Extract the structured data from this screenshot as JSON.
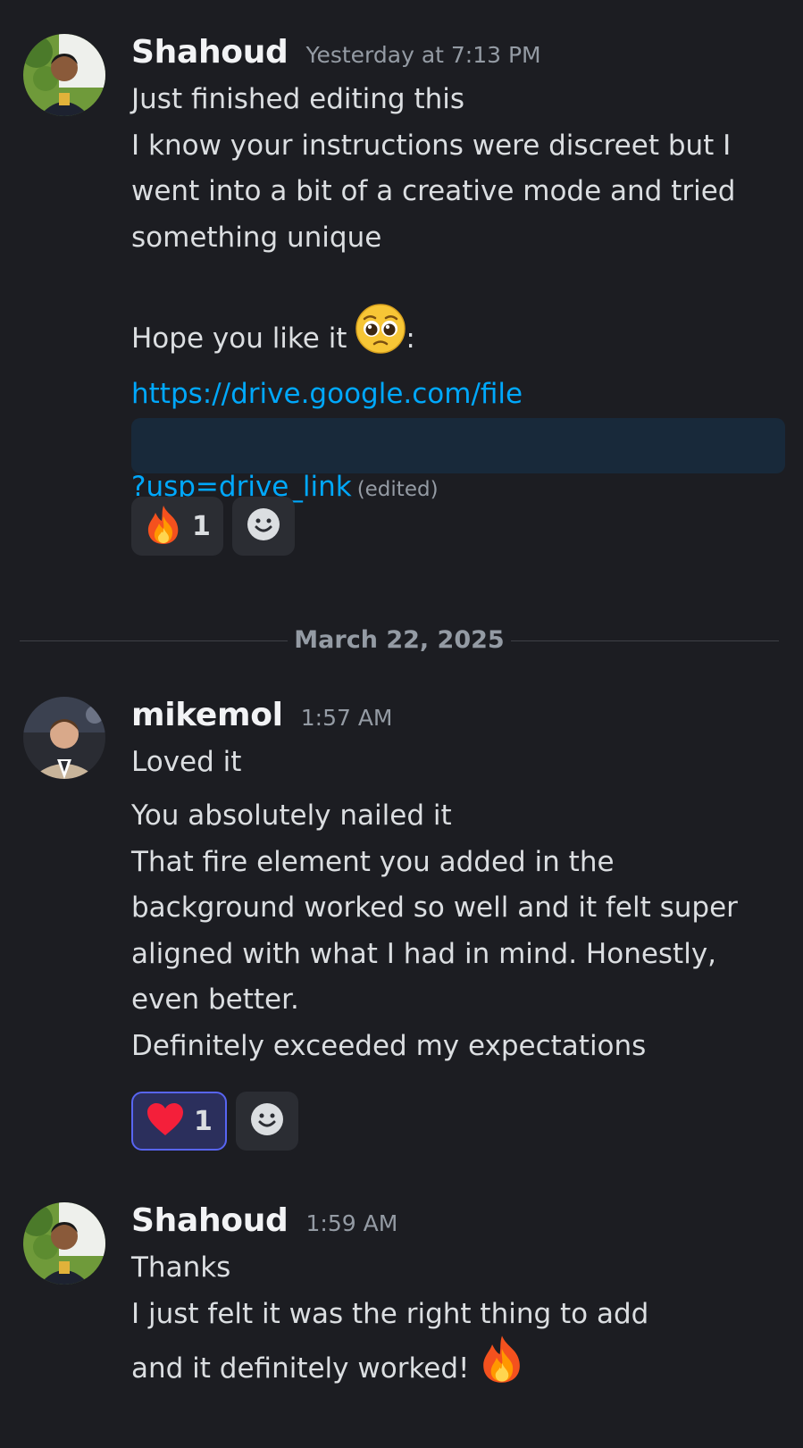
{
  "messages": [
    {
      "username": "Shahoud",
      "timestamp": "Yesterday at 7:13 PM",
      "avatar_icon": "user-avatar-shahoud",
      "lines": [
        "Just finished editing this",
        "I know your instructions were discreet but I",
        "went into a bit of a creative mode and tried",
        "something unique",
        "",
        "Hope you like it"
      ],
      "inline_emoji": "pleading-face-emoji",
      "inline_suffix": ":",
      "link_start": "https://drive.google.com/file",
      "link_end": "?usp=drive_link",
      "edited_label": "(edited)",
      "reactions": [
        {
          "emoji": "fire-emoji",
          "count": "1"
        }
      ],
      "add_reaction_icon": "add-reaction-smiley-icon"
    },
    {
      "username": "mikemol",
      "timestamp": "1:57 AM",
      "avatar_icon": "user-avatar-mikemol",
      "first_line": "Loved it",
      "lines": [
        "You absolutely nailed it",
        "That fire element you added in the",
        "background worked so well and it felt super",
        "aligned with what I had in mind. Honestly,",
        "even better.",
        "Definitely exceeded my expectations"
      ],
      "reactions": [
        {
          "emoji": "red-heart-emoji",
          "count": "1"
        }
      ],
      "add_reaction_icon": "add-reaction-smiley-icon"
    },
    {
      "username": "Shahoud",
      "timestamp": "1:59 AM",
      "avatar_icon": "user-avatar-shahoud",
      "lines": [
        "Thanks",
        "I just felt it was the right thing to add",
        "and it definitely worked!"
      ],
      "trailing_emoji": "fire-emoji"
    }
  ],
  "date_divider": "March 22, 2025",
  "colors": {
    "background": "#1c1d22",
    "text": "#dbdee1",
    "username": "#f2f3f5",
    "muted": "#949ba4",
    "link": "#00a8fc",
    "reaction_bg": "#2b2d33",
    "reaction_active_border": "#5865f2"
  }
}
